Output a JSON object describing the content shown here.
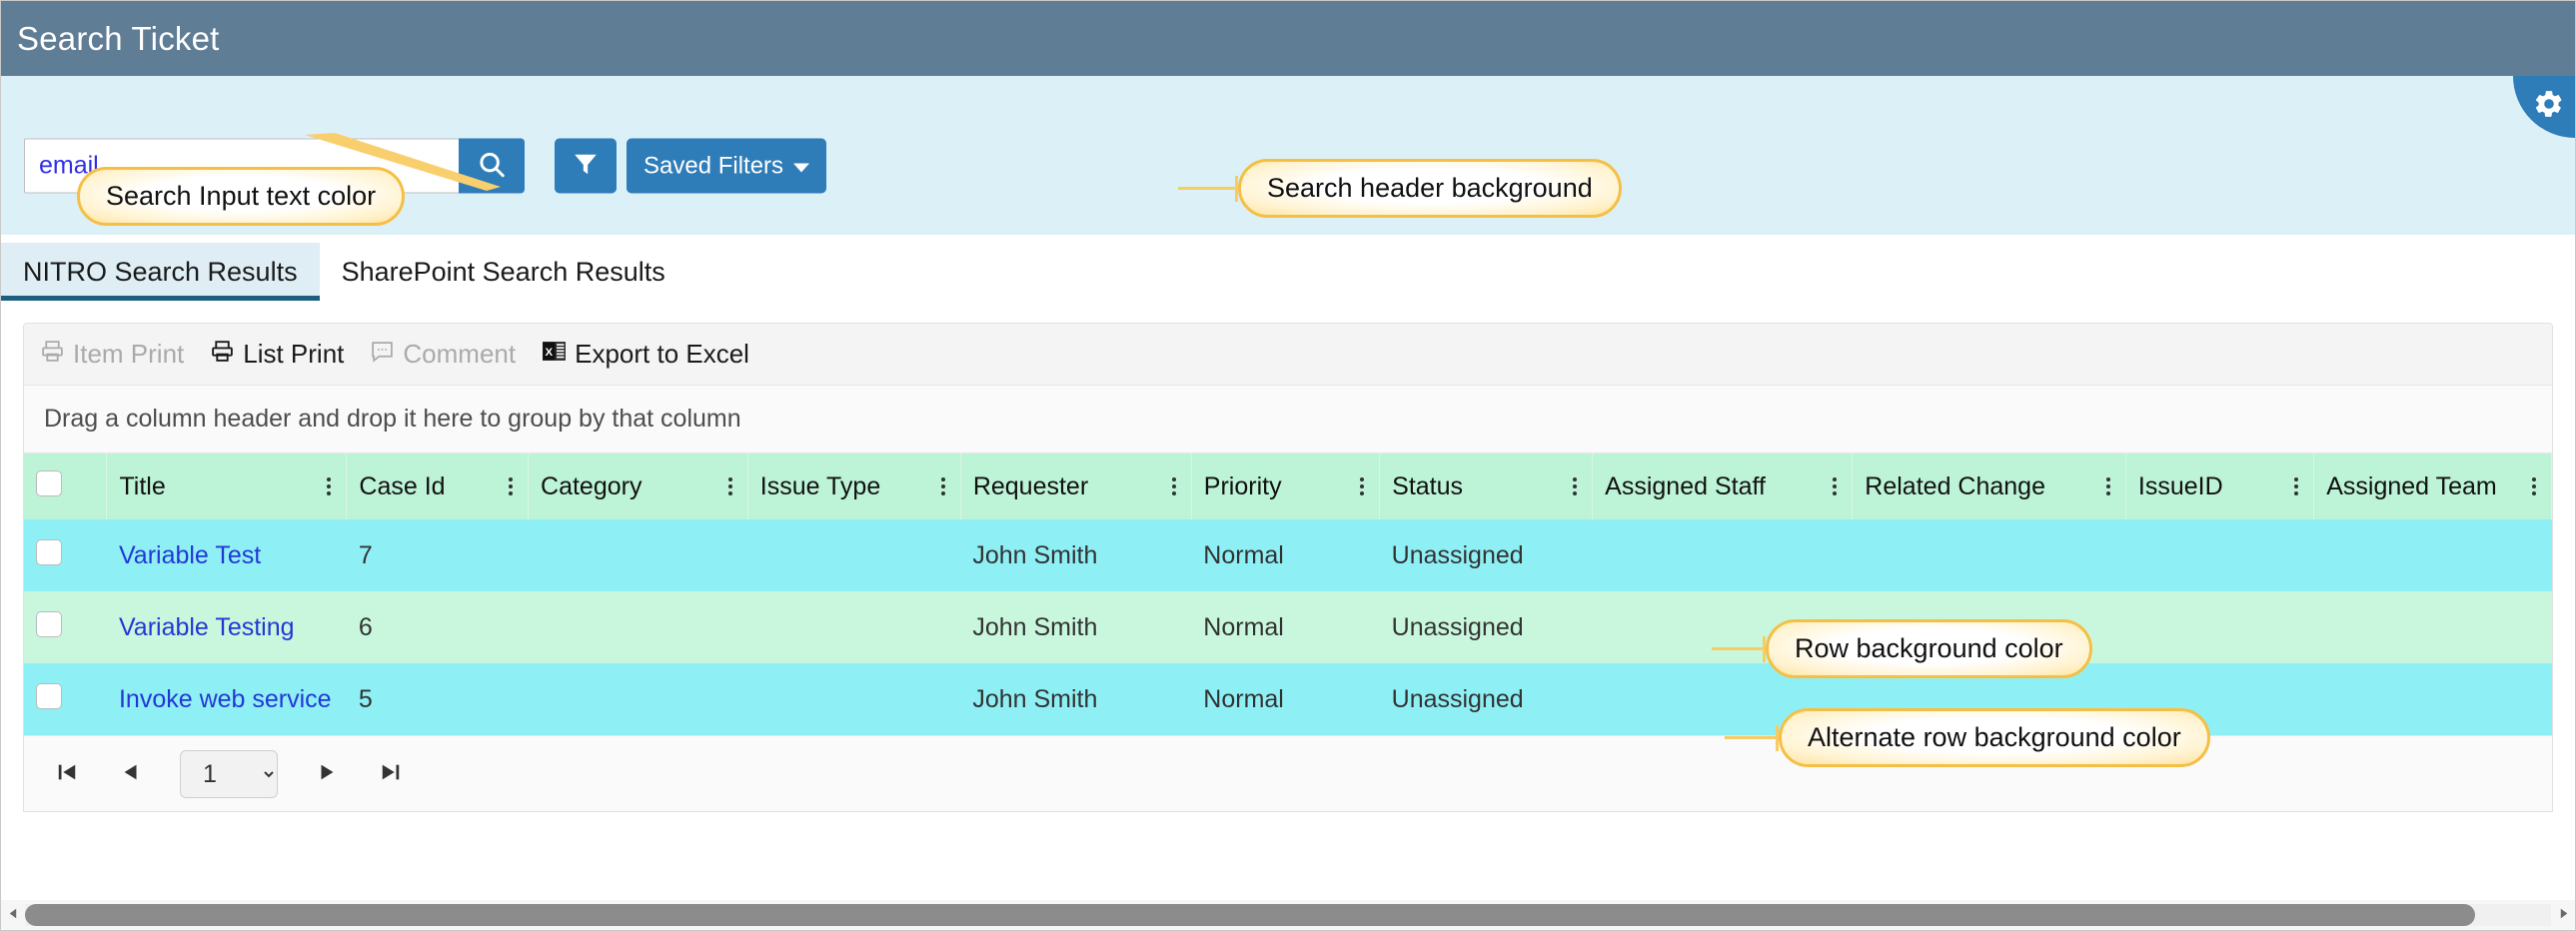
{
  "window": {
    "title": "Search Ticket"
  },
  "search": {
    "value": "email",
    "placeholder": "Search",
    "search_button_label": "",
    "filter_button_label": "",
    "saved_filters_label": "Saved Filters",
    "gear_label": ""
  },
  "tabs": [
    {
      "label": "NITRO Search Results",
      "active": true
    },
    {
      "label": "SharePoint Search Results",
      "active": false
    }
  ],
  "toolbar": {
    "items": [
      {
        "label": "Item Print",
        "icon": "printer-icon",
        "disabled": true
      },
      {
        "label": "List Print",
        "icon": "printer-icon",
        "disabled": false
      },
      {
        "label": "Comment",
        "icon": "comment-icon",
        "disabled": true
      },
      {
        "label": "Export to Excel",
        "icon": "excel-icon",
        "disabled": false
      }
    ]
  },
  "grid": {
    "group_hint": "Drag a column header and drop it here to group by that column",
    "columns": [
      "Title",
      "Case Id",
      "Category",
      "Issue Type",
      "Requester",
      "Priority",
      "Status",
      "Assigned Staff",
      "Related Change",
      "IssueID",
      "Assigned Team"
    ],
    "rows": [
      {
        "Title": "Variable Test",
        "Case Id": "7",
        "Category": "",
        "Issue Type": "",
        "Requester": "John Smith",
        "Priority": "Normal",
        "Status": "Unassigned",
        "Assigned Staff": "",
        "Related Change": "",
        "IssueID": "",
        "Assigned Team": ""
      },
      {
        "Title": "Variable Testing",
        "Case Id": "6",
        "Category": "",
        "Issue Type": "",
        "Requester": "John Smith",
        "Priority": "Normal",
        "Status": "Unassigned",
        "Assigned Staff": "",
        "Related Change": "",
        "IssueID": "",
        "Assigned Team": ""
      },
      {
        "Title": "Invoke web service",
        "Case Id": "5",
        "Category": "",
        "Issue Type": "",
        "Requester": "John Smith",
        "Priority": "Normal",
        "Status": "Unassigned",
        "Assigned Staff": "",
        "Related Change": "",
        "IssueID": "",
        "Assigned Team": ""
      }
    ]
  },
  "pager": {
    "first_label": "",
    "prev_label": "",
    "page_value": "1",
    "page_options": [
      "1"
    ],
    "next_label": "",
    "last_label": ""
  },
  "callouts": {
    "search_input_text_color": "Search Input text color",
    "search_header_background": "Search header background",
    "row_background_color": "Row background color",
    "alternate_row_background_color": "Alternate row background color"
  },
  "colors": {
    "titlebar": "#5f7d95",
    "search_header_bg": "#dcf0f8",
    "search_input_text": "#2f2fe8",
    "accent_blue": "#2e7cb8",
    "tab_active_underline": "#1c5f80",
    "grid_header_bg": "#bdf3d6",
    "row_bg": "#8ef0f5",
    "row_alt_bg": "#c9f7dd",
    "link": "#2437d6",
    "callout_border": "#f5bf45"
  }
}
